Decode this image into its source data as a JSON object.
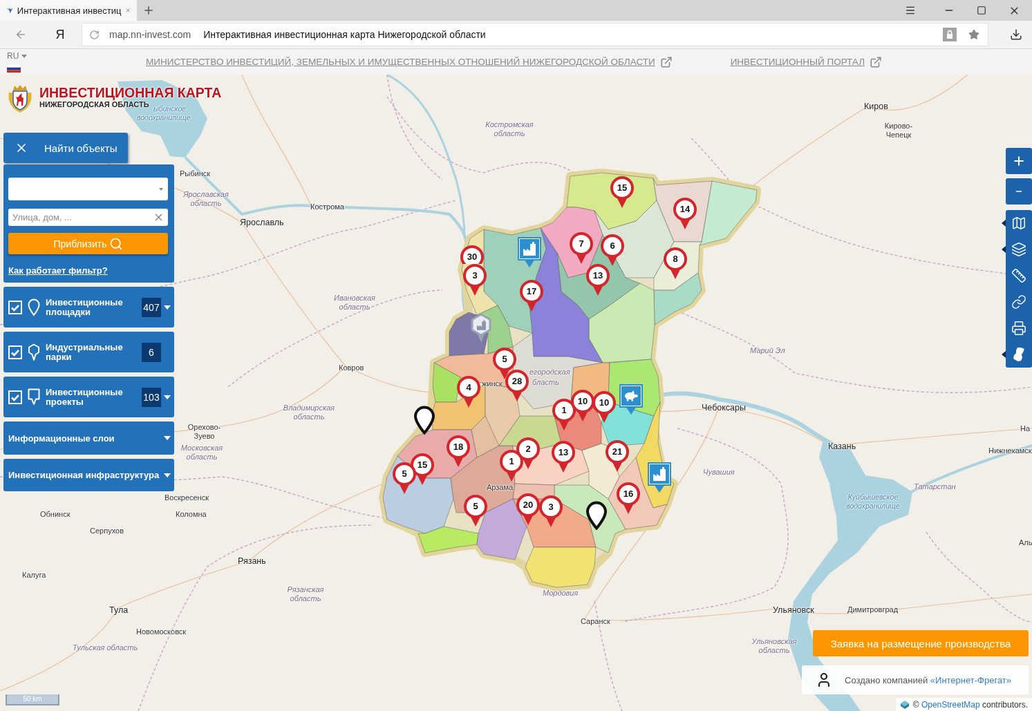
{
  "browser": {
    "tab_title": "Интерактивная инвестиц",
    "home_button": "Я",
    "domain": "map.nn-invest.com",
    "page_title": "Интерактивная инвестиционная карта Нижегородской области"
  },
  "header": {
    "language": "RU",
    "links": [
      {
        "label": "МИНИСТЕРСТВО ИНВЕСТИЦИЙ, ЗЕМЕЛЬНЫХ И ИМУЩЕСТВЕННЫХ ОТНОШЕНИЙ НИЖЕГОРОДСКОЙ ОБЛАСТИ"
      },
      {
        "label": "ИНВЕСТИЦИОННЫЙ ПОРТАЛ"
      }
    ]
  },
  "logo": {
    "title": "ИНВЕСТИЦИОННАЯ КАРТА",
    "subtitle": "НИЖЕГОРОДСКАЯ ОБЛАСТЬ"
  },
  "search": {
    "toggle_label": "Найти объекты",
    "address_field": {
      "placeholder": "Улица, дом, ..."
    },
    "zoom_button": "Приблизить",
    "help_link": "Как работает фильтр?"
  },
  "layers": [
    {
      "kind": "round_pin",
      "label": "Инвестиционные площадки",
      "checked": true,
      "count": "407",
      "dropdown": true
    },
    {
      "kind": "hexagon_pin",
      "label": "Индустриальные парки",
      "checked": true,
      "count": "6",
      "dropdown": false
    },
    {
      "kind": "square_pin",
      "label": "Инвестиционные проекты",
      "checked": true,
      "count": "103",
      "dropdown": true
    }
  ],
  "sections": [
    {
      "label": "Информационные слои"
    },
    {
      "label": "Инвестиционная инфраструктура"
    }
  ],
  "map": {
    "place_labels": [
      {
        "text": "ыбинское",
        "kind": "water"
      },
      {
        "text": "Киров",
        "kind": "major_city"
      },
      {
        "text": "водохранилище",
        "kind": "water"
      },
      {
        "text": "Костромская область",
        "kind": "region"
      },
      {
        "text": "Кирово-Чепецк",
        "kind": "city"
      },
      {
        "text": "Рыбинск",
        "kind": "city"
      },
      {
        "text": "Ярославская область",
        "kind": "region"
      },
      {
        "text": "Кострома",
        "kind": "city"
      },
      {
        "text": "Ярославль",
        "kind": "major_city"
      },
      {
        "text": "Ивановская область",
        "kind": "region"
      },
      {
        "text": "Марий Эл",
        "kind": "region"
      },
      {
        "text": "Ковров",
        "kind": "city"
      },
      {
        "text": "егородская",
        "kind": "region"
      },
      {
        "text": "жинск",
        "kind": "city"
      },
      {
        "text": "бласть",
        "kind": "region"
      },
      {
        "text": "Владимирская область",
        "kind": "region"
      },
      {
        "text": "Чебоксары",
        "kind": "major_city"
      },
      {
        "text": "Орехово-Зуево",
        "kind": "city"
      },
      {
        "text": "На",
        "kind": "city"
      },
      {
        "text": "Московская область",
        "kind": "region"
      },
      {
        "text": "Казань",
        "kind": "major_city"
      },
      {
        "text": "Нижнекамск",
        "kind": "city"
      },
      {
        "text": "Чувашия",
        "kind": "region"
      },
      {
        "text": "Арзама",
        "kind": "city"
      },
      {
        "text": "Татарстан",
        "kind": "region"
      },
      {
        "text": "Воскресенск",
        "kind": "city"
      },
      {
        "text": "Куйбышевское водохранилище",
        "kind": "water"
      },
      {
        "text": "Обнинск",
        "kind": "city"
      },
      {
        "text": "Коломна",
        "kind": "city"
      },
      {
        "text": "Серпухов",
        "kind": "city"
      },
      {
        "text": "Аль",
        "kind": "city"
      },
      {
        "text": "Рязань",
        "kind": "major_city"
      },
      {
        "text": "Калуга",
        "kind": "city"
      },
      {
        "text": "Рязанская область",
        "kind": "region"
      },
      {
        "text": "Мордовия",
        "kind": "region"
      },
      {
        "text": "Тула",
        "kind": "major_city"
      },
      {
        "text": "Ульяновск",
        "kind": "major_city"
      },
      {
        "text": "Димитровград",
        "kind": "city"
      },
      {
        "text": "Саранск",
        "kind": "city"
      },
      {
        "text": "Новомосковск",
        "kind": "city"
      },
      {
        "text": "Тульская область",
        "kind": "region"
      },
      {
        "text": "Ульяновская область",
        "kind": "region"
      }
    ],
    "markers": [
      {
        "kind": "cluster",
        "count": "15"
      },
      {
        "kind": "cluster",
        "count": "14"
      },
      {
        "kind": "factory"
      },
      {
        "kind": "cluster",
        "count": "7"
      },
      {
        "kind": "cluster",
        "count": "6"
      },
      {
        "kind": "cluster",
        "count": "8"
      },
      {
        "kind": "cluster",
        "count": "30"
      },
      {
        "kind": "cluster",
        "count": "3"
      },
      {
        "kind": "cluster",
        "count": "13"
      },
      {
        "kind": "cluster",
        "count": "17"
      },
      {
        "kind": "park"
      },
      {
        "kind": "cluster",
        "count": "5"
      },
      {
        "kind": "cluster",
        "count": "28"
      },
      {
        "kind": "cluster",
        "count": "4"
      },
      {
        "kind": "farm"
      },
      {
        "kind": "cluster",
        "count": "1"
      },
      {
        "kind": "cluster",
        "count": "10"
      },
      {
        "kind": "cluster",
        "count": "10"
      },
      {
        "kind": "pin"
      },
      {
        "kind": "cluster",
        "count": "18"
      },
      {
        "kind": "cluster",
        "count": "1"
      },
      {
        "kind": "cluster",
        "count": "2"
      },
      {
        "kind": "cluster",
        "count": "13"
      },
      {
        "kind": "cluster",
        "count": "21"
      },
      {
        "kind": "cluster",
        "count": "15"
      },
      {
        "kind": "cluster",
        "count": "5"
      },
      {
        "kind": "factory"
      },
      {
        "kind": "cluster",
        "count": "16"
      },
      {
        "kind": "cluster",
        "count": "5"
      },
      {
        "kind": "cluster",
        "count": "20"
      },
      {
        "kind": "cluster",
        "count": "3"
      },
      {
        "kind": "pin"
      }
    ],
    "scale": "50 km"
  },
  "request_button": "Заявка на размещение производства",
  "credit": {
    "text": "Создано компанией",
    "link": "«Интернет-Фрегат»"
  },
  "attribution": {
    "prefix": "©",
    "link": "OpenStreetMap",
    "suffix": "contributors."
  }
}
